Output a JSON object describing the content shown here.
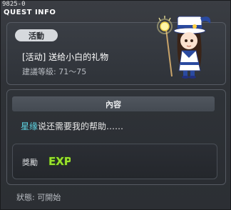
{
  "window": {
    "quest_id": "9825-0",
    "title": "QUEST INFO"
  },
  "quest": {
    "category_badge": "活動",
    "name": "[活动] 送给小白的礼物",
    "recommended_level": "建議等級: 71～75"
  },
  "content": {
    "header": "內容",
    "npc_name": "星缘",
    "description_rest": "说还需要我的帮助……"
  },
  "reward": {
    "label": "獎勵",
    "icon": "exp-icon",
    "icon_text": "EXP"
  },
  "status": {
    "text": "狀態: 可開始"
  },
  "colors": {
    "npc_name": "#5fd7e6",
    "exp_fill": "#9be02e",
    "badge_bg": "#d6d9dd"
  }
}
